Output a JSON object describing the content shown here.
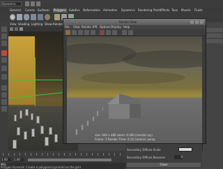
{
  "top_bar": {
    "mode": "Dynamics"
  },
  "shelf_tabs": [
    {
      "label": "General"
    },
    {
      "label": "Curves"
    },
    {
      "label": "Surfaces"
    },
    {
      "label": "Polygons",
      "active": true
    },
    {
      "label": "Subdivs"
    },
    {
      "label": "Deformation"
    },
    {
      "label": "Animation"
    },
    {
      "label": "Dynamics"
    },
    {
      "label": "Rendering"
    },
    {
      "label": "PaintEffects"
    },
    {
      "label": "Toon"
    },
    {
      "label": "Muscle"
    },
    {
      "label": "Fluids"
    }
  ],
  "viewport": {
    "menu": [
      "View",
      "Shading",
      "Lighting",
      "Show",
      "Renderer",
      "Panels"
    ]
  },
  "render_view": {
    "title": "Render View",
    "menu": [
      "File",
      "View",
      "Render",
      "IPR",
      "Options",
      "Display",
      "Help"
    ],
    "info": "size: 640 x 480  zoom: 0.300  (mental ray)",
    "stats": "Frame: 1   Render Time: 0:14   Camera: persp"
  },
  "attr_editor": {
    "row1_label": "Secondary Diffuse Scale",
    "row2_label": "Secondary Diffuse Bounces",
    "row2_value": "0",
    "close_label": "Close"
  },
  "timeline": {
    "start": "1.00",
    "current": "1.00"
  },
  "command_line": {
    "lang": "MEL",
    "help": "Polygon Pyramid: Create a polygonal pyramid on the grid"
  },
  "colors": {
    "accent_tab": "#5a5a5a",
    "grid": "#2ecc40",
    "active_tool": "#c24a34"
  }
}
